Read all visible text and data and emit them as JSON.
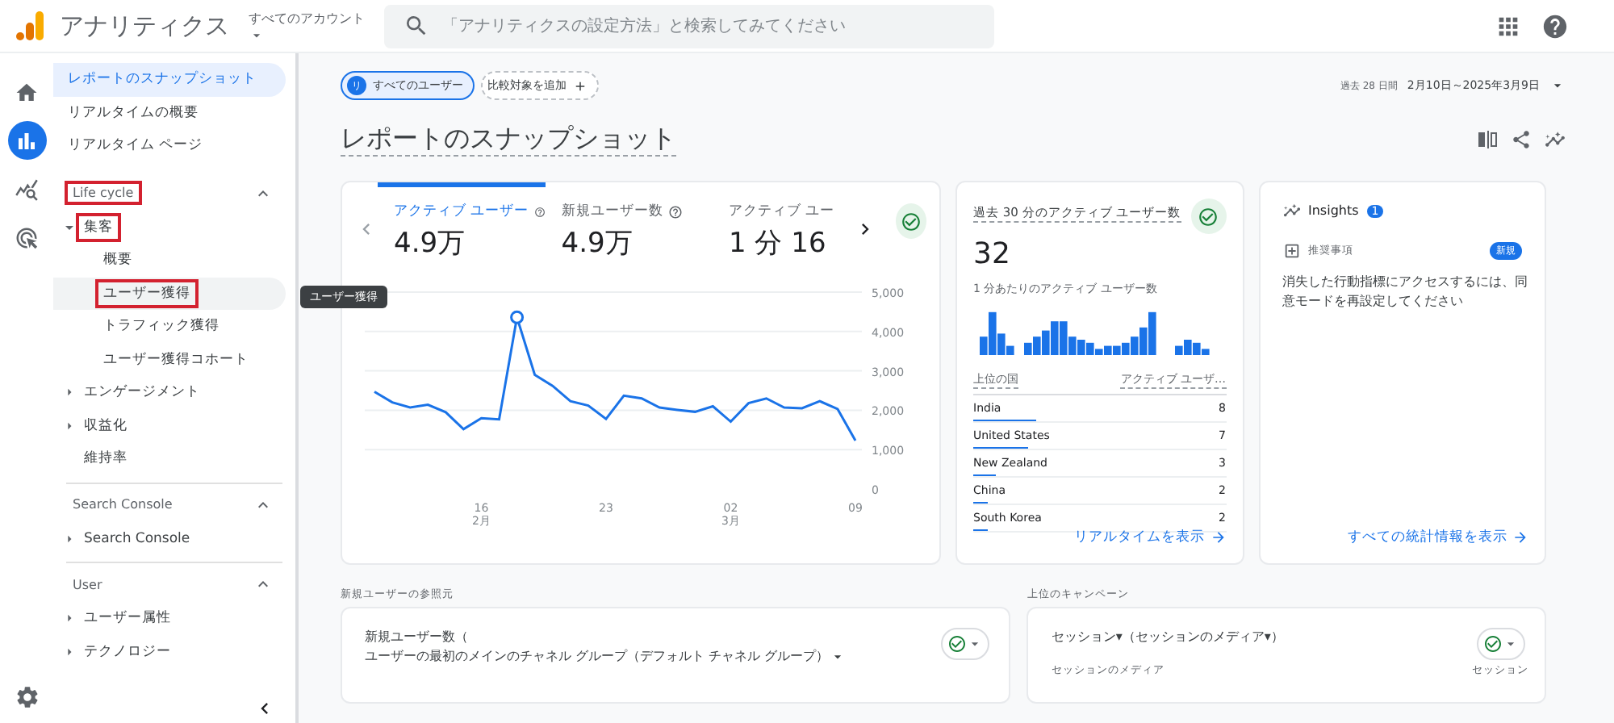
{
  "header": {
    "app_title": "アナリティクス",
    "account_label": "すべてのアカウント",
    "search": {
      "placeholder": "「アナリティクスの設定方法」と検索してみてください"
    }
  },
  "rail": {
    "items": [
      {
        "kind": "home",
        "selected": false
      },
      {
        "kind": "reports",
        "selected": true
      },
      {
        "kind": "explore",
        "selected": false
      },
      {
        "kind": "advertising",
        "selected": false
      }
    ]
  },
  "sidebar": {
    "top_items": [
      {
        "label": "レポートのスナップショット",
        "selected": true
      },
      {
        "label": "リアルタイムの概要",
        "selected": false
      },
      {
        "label": "リアルタイム ページ",
        "selected": false
      }
    ],
    "sections": [
      {
        "title": "Life cycle",
        "expanded": true,
        "highlighted": true,
        "items": [
          {
            "label": "集客",
            "kind": "folder",
            "expanded": true,
            "highlighted": true,
            "hovered": false,
            "children": [
              {
                "label": "概要",
                "kind": "page",
                "highlighted": false,
                "hovered": false
              },
              {
                "label": "ユーザー獲得",
                "kind": "page",
                "highlighted": true,
                "hovered": true
              },
              {
                "label": "トラフィック獲得",
                "kind": "page",
                "highlighted": false,
                "hovered": false
              },
              {
                "label": "ユーザー獲得コホート",
                "kind": "page",
                "highlighted": false,
                "hovered": false
              }
            ]
          },
          {
            "label": "エンゲージメント",
            "kind": "folder",
            "expanded": false,
            "highlighted": false,
            "hovered": false
          },
          {
            "label": "収益化",
            "kind": "folder",
            "expanded": false,
            "highlighted": false,
            "hovered": false
          },
          {
            "label": "維持率",
            "kind": "page",
            "highlighted": false,
            "hovered": false
          }
        ]
      },
      {
        "title": "Search Console",
        "expanded": true,
        "highlighted": false,
        "items": [
          {
            "label": "Search Console",
            "kind": "folder",
            "expanded": false,
            "highlighted": false,
            "hovered": false
          }
        ]
      },
      {
        "title": "User",
        "expanded": true,
        "highlighted": false,
        "items": [
          {
            "label": "ユーザー属性",
            "kind": "folder",
            "expanded": false,
            "highlighted": false,
            "hovered": false
          },
          {
            "label": "テクノロジー",
            "kind": "folder",
            "expanded": false,
            "highlighted": false,
            "hovered": false
          }
        ]
      }
    ]
  },
  "tooltip": "ユーザー獲得",
  "filters": {
    "segment": {
      "avatar": "リ",
      "label": "すべてのユーザー"
    },
    "add_comparison": "比較対象を追加"
  },
  "date_range": {
    "period": "過去 28 日間",
    "range": "2月10日～2025年3月9日"
  },
  "page_title": "レポートのスナップショット",
  "overview_card": {
    "metrics": [
      {
        "label": "アクティブ ユーザー",
        "value": "4.9万",
        "selected": true,
        "help": true
      },
      {
        "label": "新規ユーザー数",
        "value": "4.9万",
        "selected": false,
        "help": true
      },
      {
        "label": "アクティブ ユー",
        "value": "1 分 16",
        "selected": false,
        "help": false
      }
    ],
    "chart_data": {
      "type": "line",
      "grid": true,
      "categories": [
        null,
        null,
        null,
        null,
        null,
        null,
        "16\n2月",
        null,
        null,
        null,
        null,
        null,
        null,
        "23",
        null,
        null,
        null,
        null,
        null,
        null,
        "02\n3月",
        null,
        null,
        null,
        null,
        null,
        null,
        "09"
      ],
      "series": [
        {
          "color": "#1a73e8",
          "values": [
            2470,
            2200,
            2070,
            2140,
            1950,
            1520,
            1800,
            1770,
            4360,
            2900,
            2620,
            2230,
            2120,
            1780,
            2370,
            2300,
            2070,
            2010,
            1960,
            2100,
            1710,
            2180,
            2300,
            2070,
            2050,
            2230,
            2030,
            1230
          ]
        }
      ],
      "ylim": [
        0,
        5000
      ],
      "yticks": [
        {
          "value": 0,
          "label": "0"
        },
        {
          "value": 1000,
          "label": "1,000"
        },
        {
          "value": 2000,
          "label": "2,000"
        },
        {
          "value": 3000,
          "label": "3,000"
        },
        {
          "value": 4000,
          "label": "4,000"
        },
        {
          "value": 5000,
          "label": "5,000"
        }
      ]
    }
  },
  "realtime_card": {
    "title": "過去 30 分のアクティブ ユーザー数",
    "value": "32",
    "subtitle": "1 分あたりのアクティブ ユーザー数",
    "col_1": "上位の国",
    "col_2": "アクティブ ユーザ…",
    "rows": [
      {
        "country": "India",
        "count": "8",
        "level": 0.25
      },
      {
        "country": "United States",
        "count": "7",
        "level": 0.22
      },
      {
        "country": "New Zealand",
        "count": "3",
        "level": 0.09
      },
      {
        "country": "China",
        "count": "2",
        "level": 0.06
      },
      {
        "country": "South Korea",
        "count": "2",
        "level": 0.06
      }
    ],
    "link": "リアルタイムを表示"
  },
  "insights_card": {
    "title": "Insights",
    "count": "1",
    "item": {
      "label": "推奨事項",
      "badge": "新規",
      "text": "消失した行動指標にアクセスするには、同意モードを再設定してください"
    },
    "link": "すべての統計情報を表示"
  },
  "bottom": [
    {
      "section": "新規ユーザーの参照元",
      "line_1": "新規ユーザー数（",
      "line_2": "ユーザーの最初のメインのチャネル グループ（デフォルト チャネル グループ）"
    },
    {
      "section": "上位のキャンペーン",
      "line_1": "セッション▾（セッションのメディア▾）",
      "col_1": "セッションのメディア",
      "col_2": "セッション"
    }
  ]
}
